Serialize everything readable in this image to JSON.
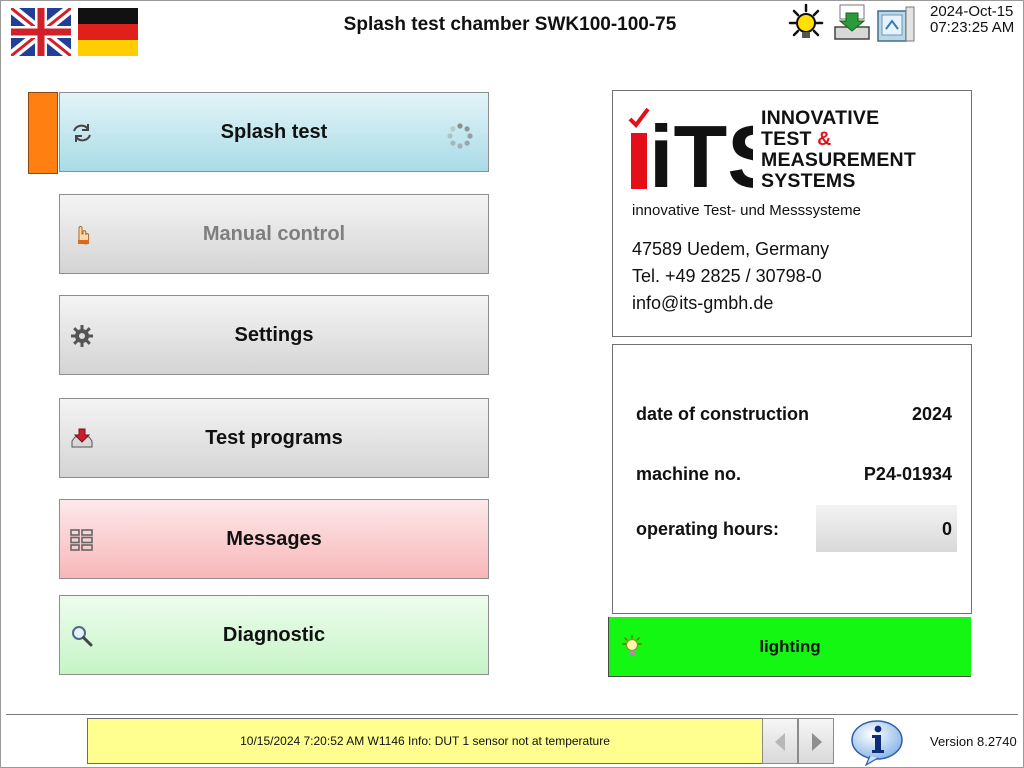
{
  "header": {
    "title": "Splash test chamber SWK100-100-75",
    "date": "2024-Oct-15",
    "time": "07:23:25 AM",
    "language_flags": [
      "flag-uk-icon",
      "flag-germany-icon"
    ],
    "top_icons": [
      "lamp-icon",
      "download-icon",
      "computer-icon"
    ]
  },
  "menu": {
    "items": [
      {
        "label": "Splash test",
        "icon": "refresh-icon",
        "selected": true
      },
      {
        "label": "Manual control",
        "icon": "hand-icon",
        "disabled": true
      },
      {
        "label": "Settings",
        "icon": "gear-icon"
      },
      {
        "label": "Test programs",
        "icon": "download-tray-icon"
      },
      {
        "label": "Messages",
        "icon": "list-icon"
      },
      {
        "label": "Diagnostic",
        "icon": "magnifier-icon"
      }
    ],
    "busy_indicator_icon": "spinner-icon"
  },
  "company": {
    "logo_letters": "iTS",
    "brand_lines": [
      "INNOVATIVE",
      "TEST",
      "&",
      "MEASUREMENT",
      "SYSTEMS"
    ],
    "tagline": "innovative Test- und Messsysteme",
    "address": "47589 Uedem, Germany",
    "phone": "Tel. +49 2825 / 30798-0",
    "email": "info@its-gmbh.de"
  },
  "machine": {
    "construction_label": "date of construction",
    "construction_value": "2024",
    "machine_no_label": "machine no.",
    "machine_no_value": "P24-01934",
    "hours_label": "operating hours:",
    "hours_value": "0"
  },
  "lighting": {
    "label": "lighting",
    "icon": "bulb-icon",
    "status_color": "#13f713"
  },
  "footer": {
    "message": "10/15/2024 7:20:52 AM W1146 Info:  DUT 1 sensor not at temperature",
    "message_bg": "#ffff8f",
    "info_icon": "info-icon",
    "version": "Version 8.2740"
  },
  "colors": {
    "selected_marker": "#ff7f11",
    "brand_red": "#e3101a"
  }
}
